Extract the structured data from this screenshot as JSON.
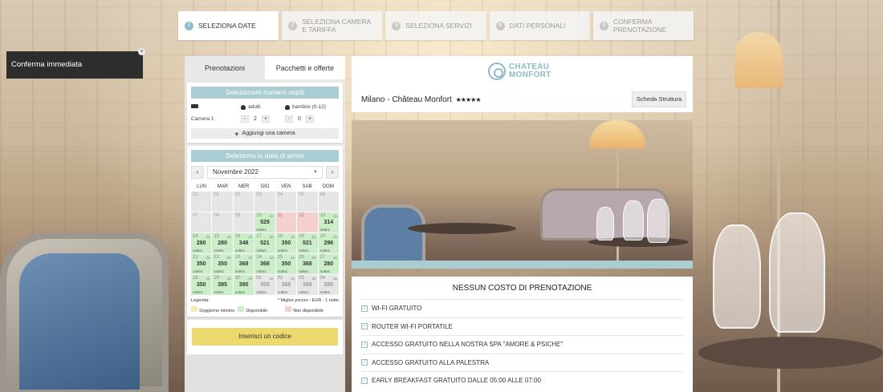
{
  "toast": {
    "text": "Conferma immediata"
  },
  "steps": [
    {
      "num": "1",
      "label": "SELEZIONA DATE"
    },
    {
      "num": "2",
      "label": "SELEZIONA CAMERA E TARIFFA"
    },
    {
      "num": "3",
      "label": "SELEZIONA SERVIZI"
    },
    {
      "num": "4",
      "label": "DATI PERSONALI"
    },
    {
      "num": "5",
      "label": "CONFERMA PRENOTAZIONE"
    }
  ],
  "tabs": {
    "booking": "Prenotazioni",
    "packages": "Pacchetti e offerte"
  },
  "guests": {
    "title": "Selezionare numero ospiti",
    "adults_label": "adulti",
    "children_label": "bambini (0-12)",
    "room_label": "Camera 1",
    "adults_value": "2",
    "children_value": "0",
    "minus": "-",
    "plus": "+",
    "add_room": "Aggiungi una camera"
  },
  "calendar": {
    "title": "Seleziona la data di arrivo",
    "month": "Novembre 2022",
    "prev": "‹",
    "next": "›",
    "weekdays": [
      "LUN",
      "MAR",
      "MER",
      "GIO",
      "VEN",
      "SAB",
      "DOM"
    ],
    "legend_label": "Legenda:",
    "legend_note": "* Miglior prezzo - EUR - 1 notte",
    "legend_min": "Soggiorno minimo",
    "legend_av": "Disponibile",
    "legend_un": "Non disponibile",
    "colors": {
      "available": "#cbeec8",
      "unavailable": "#f6cfcf",
      "past": "#e6e6e6",
      "min_stay": "#f7e9b0"
    },
    "days": [
      {
        "n": "31",
        "s": "off"
      },
      {
        "n": "01",
        "s": "off"
      },
      {
        "n": "02",
        "s": "off"
      },
      {
        "n": "03",
        "s": "off"
      },
      {
        "n": "04",
        "s": "off"
      },
      {
        "n": "05",
        "s": "off"
      },
      {
        "n": "06",
        "s": "off"
      },
      {
        "n": "07",
        "s": "off"
      },
      {
        "n": "08",
        "s": "off"
      },
      {
        "n": "09",
        "s": "off"
      },
      {
        "n": "10",
        "s": "av",
        "da": "da",
        "p": "529",
        "nt": "notte1"
      },
      {
        "n": "11",
        "s": "un"
      },
      {
        "n": "12",
        "s": "un"
      },
      {
        "n": "13",
        "s": "av",
        "da": "da",
        "p": "314",
        "nt": "notte1"
      },
      {
        "n": "14",
        "s": "av",
        "da": "da",
        "p": "280",
        "nt": "notte1"
      },
      {
        "n": "15",
        "s": "av",
        "da": "da",
        "p": "280",
        "nt": "notte1"
      },
      {
        "n": "16",
        "s": "av",
        "da": "da",
        "p": "348",
        "nt": "notte1"
      },
      {
        "n": "17",
        "s": "av",
        "da": "da",
        "p": "521",
        "nt": "notte1"
      },
      {
        "n": "18",
        "s": "av",
        "da": "da",
        "p": "350",
        "nt": "notte1"
      },
      {
        "n": "19",
        "s": "av",
        "da": "da",
        "p": "521",
        "nt": "notte1"
      },
      {
        "n": "20",
        "s": "av",
        "da": "da",
        "p": "296",
        "nt": "notte1"
      },
      {
        "n": "21",
        "s": "av",
        "da": "da",
        "p": "350",
        "nt": "notte1"
      },
      {
        "n": "22",
        "s": "av",
        "da": "da",
        "p": "350",
        "nt": "notte1"
      },
      {
        "n": "23",
        "s": "av",
        "da": "da",
        "p": "368",
        "nt": "notte1"
      },
      {
        "n": "24",
        "s": "av",
        "da": "da",
        "p": "368",
        "nt": "notte1"
      },
      {
        "n": "25",
        "s": "av",
        "da": "da",
        "p": "350",
        "nt": "notte1"
      },
      {
        "n": "26",
        "s": "av",
        "da": "da",
        "p": "368",
        "nt": "notte1"
      },
      {
        "n": "27",
        "s": "av",
        "da": "da",
        "p": "280",
        "nt": "notte1"
      },
      {
        "n": "28",
        "s": "av",
        "da": "da",
        "p": "350",
        "nt": "notte1"
      },
      {
        "n": "29",
        "s": "av",
        "da": "da",
        "p": "395",
        "nt": "notte1"
      },
      {
        "n": "30",
        "s": "av",
        "da": "da",
        "p": "395",
        "nt": "notte1"
      },
      {
        "n": "01",
        "s": "grey",
        "da": "da",
        "p": "350",
        "nt": "notte1"
      },
      {
        "n": "02",
        "s": "grey",
        "da": "da",
        "p": "368",
        "nt": "notte1"
      },
      {
        "n": "03",
        "s": "grey",
        "da": "da",
        "p": "368",
        "nt": "notte1"
      },
      {
        "n": "04",
        "s": "grey",
        "da": "da",
        "p": "280",
        "nt": "notte1"
      }
    ]
  },
  "promo": {
    "button": "Inserisci un codice"
  },
  "hotel": {
    "logo_line1": "CHATEAU",
    "logo_line2": "MONFORT",
    "name": "Milano - Château Monfort",
    "stars": "★★★★★",
    "details_button": "Scheda Struttura",
    "accent": "#8dbbc6"
  },
  "benefits": {
    "title": "NESSUN COSTO DI PRENOTAZIONE",
    "items": [
      "WI-FI GRATUITO",
      "ROUTER WI-FI PORTATILE",
      "ACCESSO GRATUITO NELLA NOSTRA SPA \"AMORE & PSICHE\"",
      "ACCESSO GRATUITO ALLA PALESTRA",
      "EARLY BREAKFAST GRATUITO DALLE 05:00 ALLE 07:00"
    ]
  },
  "icons": {
    "check": "check-icon",
    "person": "person-icon",
    "bed": "bed-icon",
    "plus": "plus-icon",
    "logo": "hotel-logo-icon"
  }
}
